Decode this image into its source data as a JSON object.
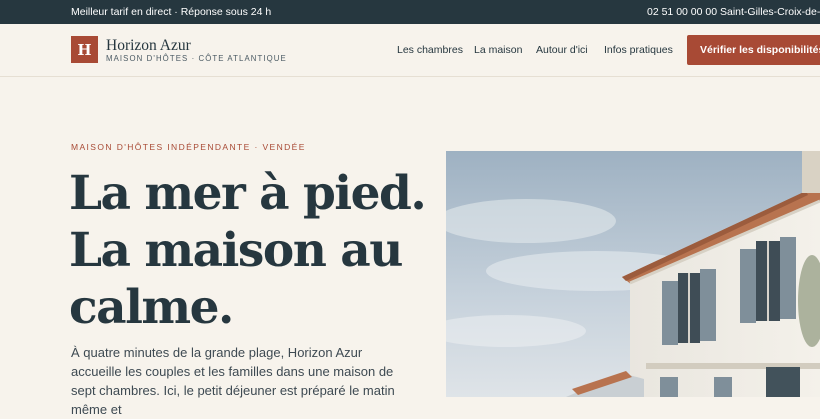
{
  "topbar": {
    "tagline": "Meilleur tarif en direct · Réponse sous 24 h",
    "phone": "02 51 00 00 00",
    "city": "Saint-Gilles-Croix-de-Vie"
  },
  "brand": {
    "initial": "H",
    "name": "Horizon Azur",
    "tagline": "MAISON D'HÔTES · CÔTE ATLANTIQUE"
  },
  "nav": {
    "items": [
      {
        "label": "Les chambres"
      },
      {
        "label": "La maison"
      },
      {
        "label": "Autour d'ici"
      },
      {
        "label": "Infos pratiques"
      }
    ],
    "cta": "Vérifier les disponibilités"
  },
  "hero": {
    "eyebrow": "MAISON D'HÔTES INDÉPENDANTE · VENDÉE",
    "headline_lines": [
      "La mer à pied.",
      "La maison au",
      "calme."
    ],
    "intro": "À quatre minutes de la grande plage, Horizon Azur accueille les couples et les familles dans une maison de sept chambres. Ici, le petit déjeuner est préparé le matin même et"
  },
  "colors": {
    "topbar": "#26373f",
    "accent": "#a84a35",
    "background": "#f7f3ec",
    "text": "#26373f"
  },
  "icons": {
    "logo": "letter-h-logo"
  }
}
